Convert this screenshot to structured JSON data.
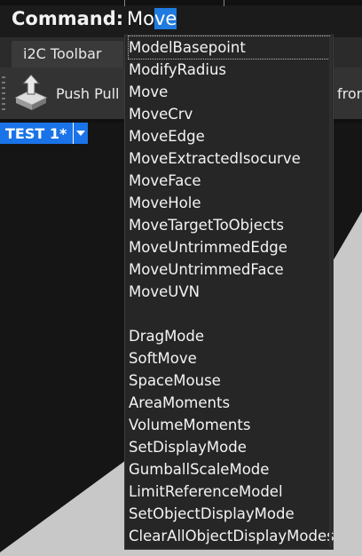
{
  "command_bar": {
    "label": "Command:",
    "typed": "Mo",
    "completion": "ve"
  },
  "toolbar": {
    "tab_label": "i2C Toolbar",
    "push_pull_label": "Push Pull",
    "cut_label": "fron"
  },
  "viewport": {
    "title": "TEST 1*"
  },
  "autocomplete": {
    "items": [
      "ModelBasepoint",
      "ModifyRadius",
      "Move",
      "MoveCrv",
      "MoveEdge",
      "MoveExtractedIsocurve",
      "MoveFace",
      "MoveHole",
      "MoveTargetToObjects",
      "MoveUntrimmedEdge",
      "MoveUntrimmedFace",
      "MoveUVN",
      "",
      "DragMode",
      "SoftMove",
      "SpaceMouse",
      "AreaMoments",
      "VolumeMoments",
      "SetDisplayMode",
      "GumballScaleMode",
      "LimitReferenceModel",
      "SetObjectDisplayMode",
      "ClearAllObjectDisplayModes"
    ],
    "selected_index": 0
  },
  "colors": {
    "accent": "#1a73e8",
    "highlight": "#1f7be0",
    "panel": "#262626",
    "text": "#f4f4f4"
  }
}
